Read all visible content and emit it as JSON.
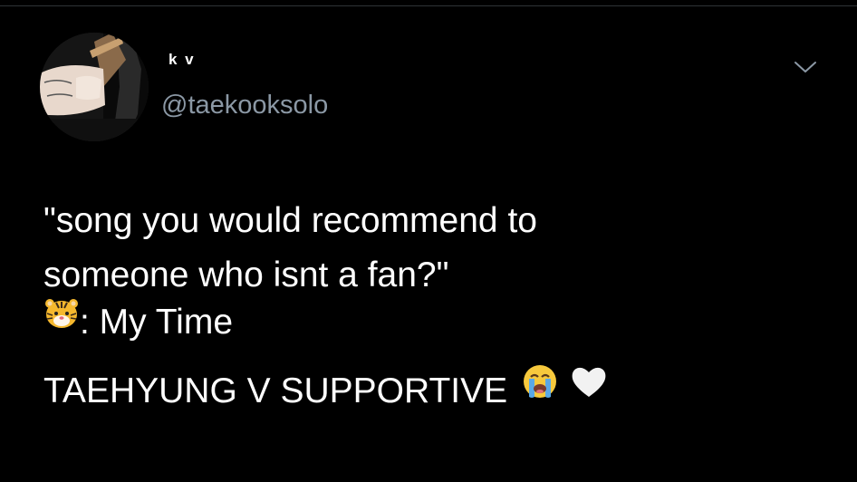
{
  "tweet": {
    "display_name": "k v",
    "handle": "@taekooksolo",
    "more_icon": "chevron-down-icon",
    "avatar_icon": "avatar-photo",
    "lines": [
      "\"song you would recommend to",
      "someone who isnt a fan?\"",
      ": My Time",
      "TAEHYUNG V SUPPORTIVE"
    ],
    "emojis": [
      "tiger-face-emoji",
      "loudly-crying-face-emoji",
      "white-heart-emoji"
    ]
  },
  "colors": {
    "background": "#000000",
    "text": "#ffffff",
    "handle": "#8b98a5",
    "divider": "#2f3336"
  }
}
